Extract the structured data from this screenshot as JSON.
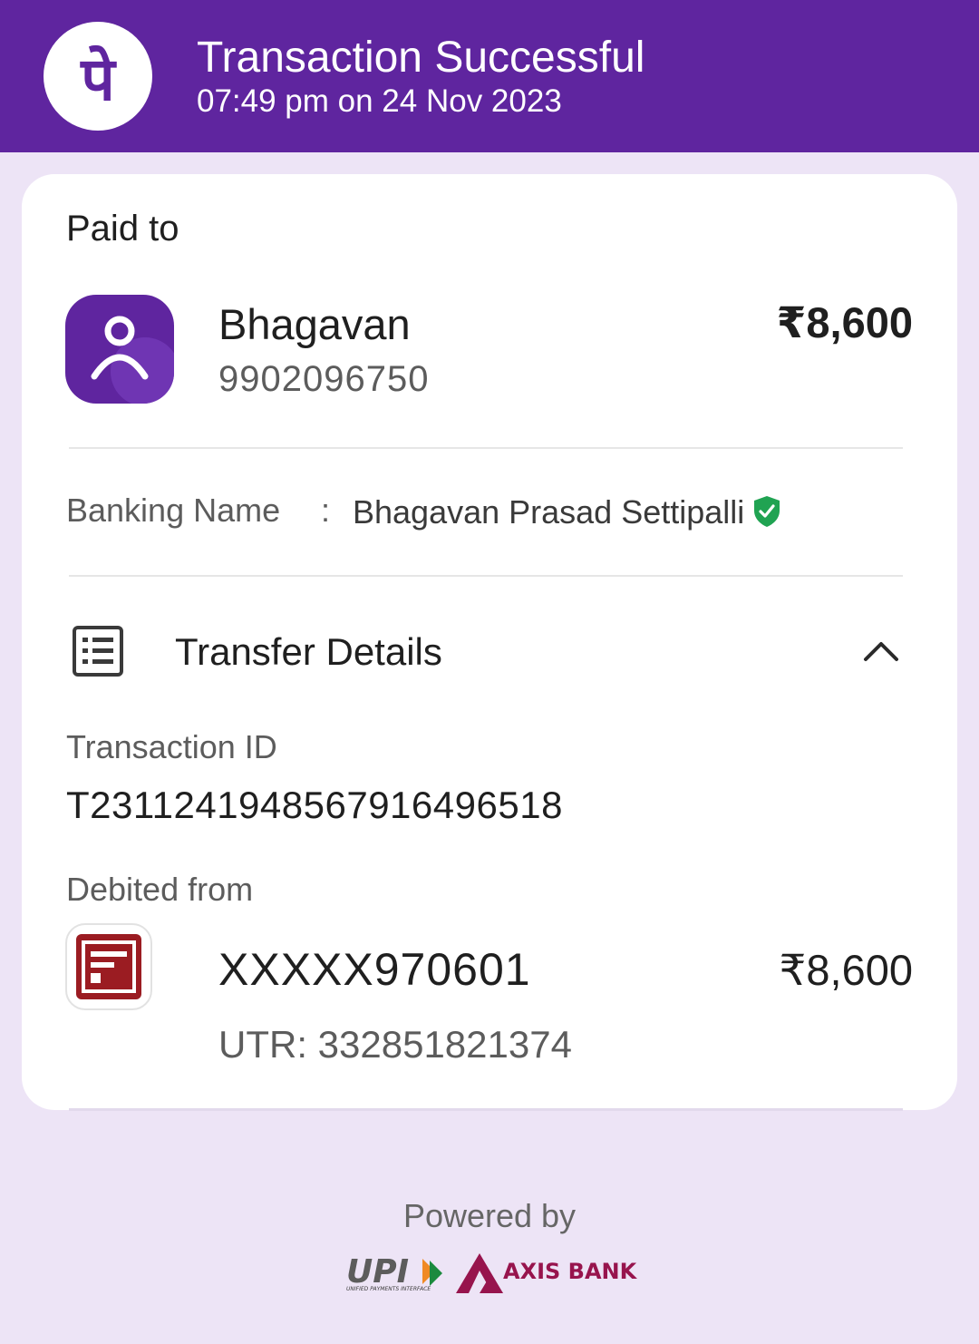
{
  "header": {
    "title": "Transaction Successful",
    "subtitle": "07:49 pm on 24 Nov 2023",
    "logo_icon": "phonepe-logo-icon",
    "logo_glyph": "पे",
    "brand_color": "#5f259f"
  },
  "payee": {
    "section_label": "Paid to",
    "avatar_icon": "person-icon",
    "name": "Bhagavan",
    "phone": "9902096750",
    "amount": "₹8,600"
  },
  "banking": {
    "label": "Banking Name",
    "separator": ":",
    "value": "Bhagavan Prasad Settipalli",
    "verified_icon": "verified-shield-icon",
    "verified_color": "#20a352"
  },
  "transfer_details": {
    "title": "Transfer Details",
    "icon": "list-document-icon",
    "toggle_icon": "chevron-up-icon",
    "transaction_id_label": "Transaction ID",
    "transaction_id": "T2311241948567916496518",
    "debited_label": "Debited from",
    "bank_icon": "bank-logo-icon",
    "account": "XXXXX970601",
    "amount": "₹8,600",
    "utr": "UTR: 332851821374"
  },
  "footer": {
    "powered_by": "Powered by",
    "upi_text": "UPI",
    "upi_caption": "UNIFIED PAYMENTS INTERFACE",
    "bank_name": "AXIS BANK",
    "axis_color": "#97144d"
  }
}
